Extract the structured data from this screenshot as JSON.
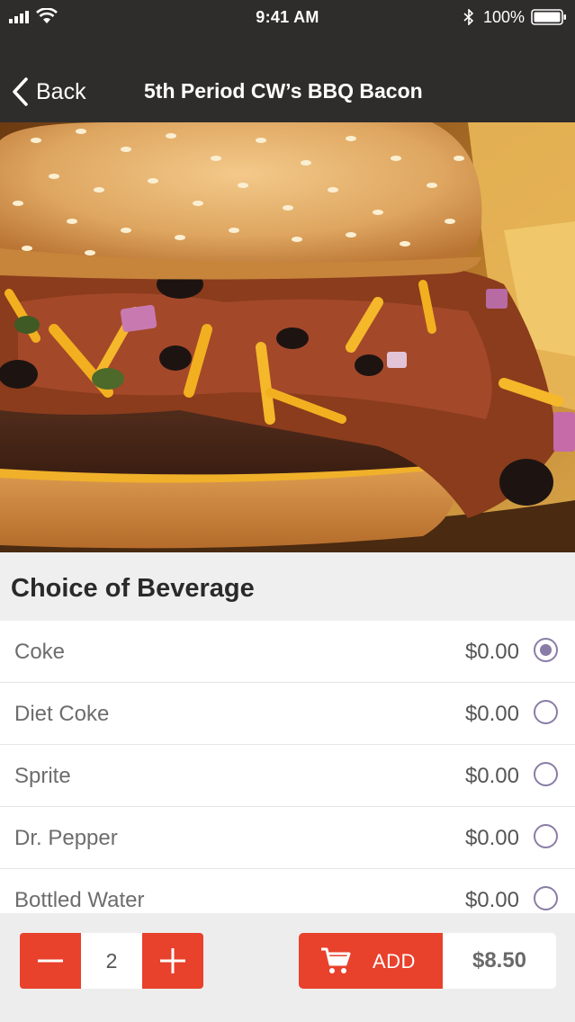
{
  "status_bar": {
    "time": "9:41 AM",
    "battery": "100%"
  },
  "nav": {
    "back_label": "Back",
    "title": "5th Period CW’s BBQ Bacon"
  },
  "hero": {
    "alt": "burger-photo"
  },
  "section": {
    "title": "Choice of Beverage"
  },
  "options": [
    {
      "label": "Coke",
      "price": "$0.00",
      "selected": true
    },
    {
      "label": "Diet Coke",
      "price": "$0.00",
      "selected": false
    },
    {
      "label": "Sprite",
      "price": "$0.00",
      "selected": false
    },
    {
      "label": "Dr. Pepper",
      "price": "$0.00",
      "selected": false
    },
    {
      "label": "Bottled Water",
      "price": "$0.00",
      "selected": false
    }
  ],
  "cart": {
    "quantity": "2",
    "add_label": "ADD",
    "total": "$8.50"
  },
  "colors": {
    "header": "#2f2d2b",
    "accent": "#e8412c",
    "radio": "#8a7ca6"
  }
}
